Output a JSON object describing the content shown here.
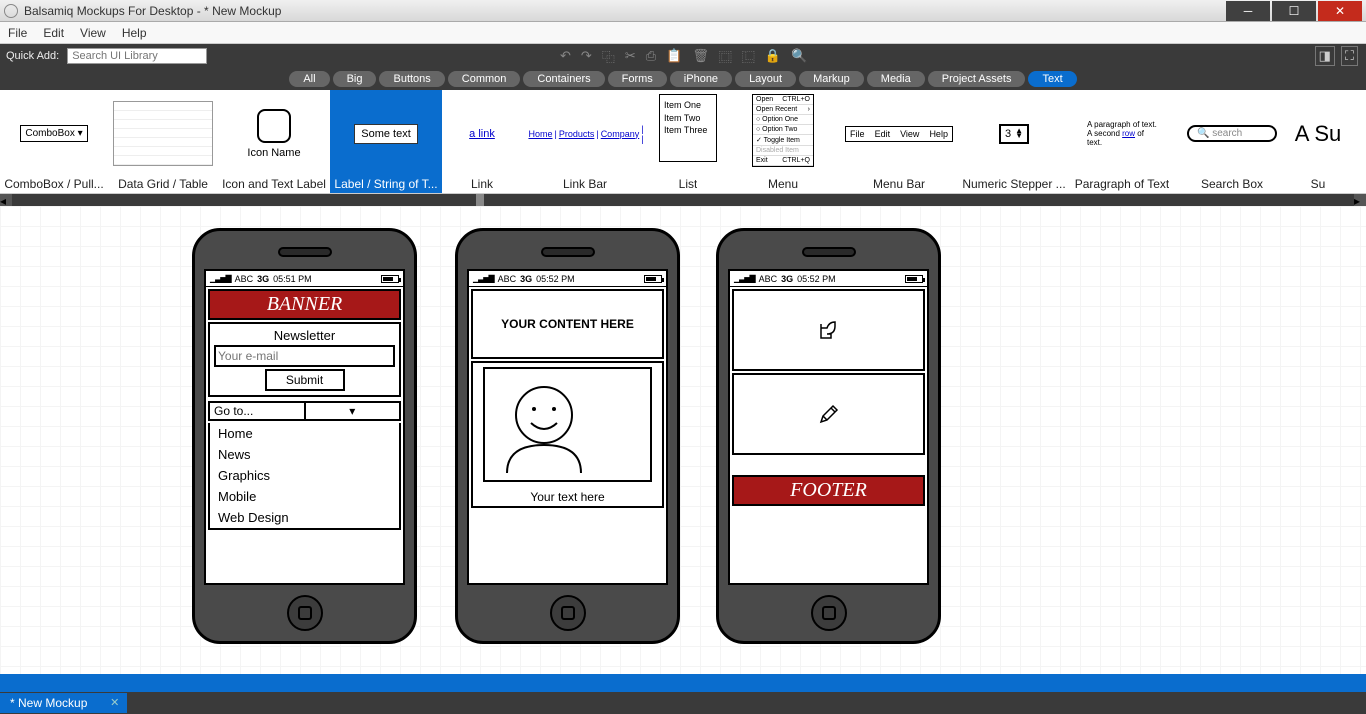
{
  "window": {
    "title": "Balsamiq Mockups For Desktop - * New Mockup"
  },
  "menu": [
    "File",
    "Edit",
    "View",
    "Help"
  ],
  "quickadd": {
    "label": "Quick Add:",
    "placeholder": "Search UI Library"
  },
  "categories": [
    "All",
    "Big",
    "Buttons",
    "Common",
    "Containers",
    "Forms",
    "iPhone",
    "Layout",
    "Markup",
    "Media",
    "Project Assets",
    "Text"
  ],
  "active_category": "Text",
  "library": {
    "combobox": {
      "label": "ComboBox / Pull...",
      "text": "ComboBox ▾"
    },
    "datagrid": {
      "label": "Data Grid / Table"
    },
    "icontext": {
      "label": "Icon and Text Label",
      "text": "Icon Name"
    },
    "labelitem": {
      "label": "Label / String of T...",
      "text": "Some text"
    },
    "link": {
      "label": "Link",
      "text": "a link"
    },
    "linkbar": {
      "label": "Link Bar",
      "items": [
        "Home",
        "Products",
        "Company"
      ]
    },
    "list": {
      "label": "List",
      "items": [
        "Item One",
        "Item Two",
        "Item Three"
      ]
    },
    "menu": {
      "label": "Menu",
      "rows": [
        [
          "Open",
          "CTRL+O"
        ],
        [
          "Open Recent",
          "›"
        ],
        [
          "○ Option One",
          ""
        ],
        [
          "○ Option Two",
          ""
        ],
        [
          "✓ Toggle Item",
          ""
        ],
        [
          "Disabled Item",
          ""
        ],
        [
          "Exit",
          "CTRL+Q"
        ]
      ]
    },
    "menubar": {
      "label": "Menu Bar",
      "items": [
        "File",
        "Edit",
        "View",
        "Help"
      ]
    },
    "stepper": {
      "label": "Numeric Stepper ...",
      "value": "3"
    },
    "paragraph": {
      "label": "Paragraph of Text",
      "text": "A paragraph of text. A second row of text."
    },
    "searchbox": {
      "label": "Search Box",
      "text": "🔍 search"
    },
    "subtitle": {
      "label": "Su",
      "text": "A Su"
    }
  },
  "status": {
    "carrier": "ABC",
    "net": "3G",
    "time1": "05:51 PM",
    "time2": "05:52 PM",
    "time3": "05:52 PM"
  },
  "mockup1": {
    "banner": "BANNER",
    "newsletter": {
      "heading": "Newsletter",
      "placeholder": "Your e-mail",
      "submit": "Submit"
    },
    "goto": "Go to...",
    "pages": [
      "Home",
      "News",
      "Graphics",
      "Mobile",
      "Web Design"
    ]
  },
  "mockup2": {
    "content": "YOUR CONTENT HERE",
    "caption": "Your text here"
  },
  "mockup3": {
    "footer": "FOOTER"
  },
  "tab": {
    "name": "* New Mockup"
  }
}
